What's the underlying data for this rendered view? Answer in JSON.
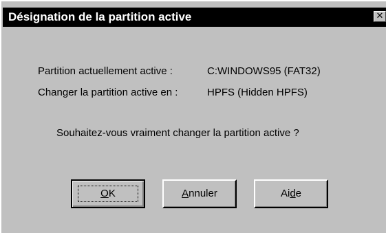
{
  "dialog": {
    "title": "Désignation de la partition active",
    "close_glyph": "✕"
  },
  "info": {
    "current_label": "Partition actuellement active :",
    "current_value": "C:WINDOWS95 (FAT32)",
    "change_label": "Changer la partition active en :",
    "change_value": "HPFS (Hidden HPFS)"
  },
  "question": "Souhaitez-vous vraiment changer la partition active ?",
  "buttons": {
    "ok": {
      "label_underlined": "O",
      "label_rest": "K"
    },
    "cancel": {
      "label_underlined": "A",
      "label_rest": "nnuler"
    },
    "help": {
      "label_before": "Ai",
      "label_underlined": "d",
      "label_after": "e"
    }
  },
  "colors": {
    "face": "#c0c0c0",
    "titlebar": "#000000"
  }
}
